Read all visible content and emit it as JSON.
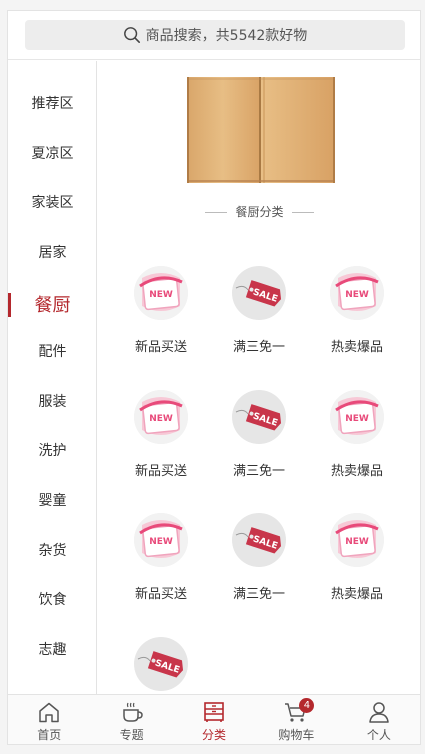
{
  "search": {
    "placeholder": "商品搜索，共5542款好物"
  },
  "sidebar": {
    "items": [
      {
        "label": "推荐区"
      },
      {
        "label": "夏凉区"
      },
      {
        "label": "家装区"
      },
      {
        "label": "居家"
      },
      {
        "label": "餐厨",
        "active": true
      },
      {
        "label": "配件"
      },
      {
        "label": "服装"
      },
      {
        "label": "洗护"
      },
      {
        "label": "婴童"
      },
      {
        "label": "杂货"
      },
      {
        "label": "饮食"
      },
      {
        "label": "志趣"
      }
    ]
  },
  "content": {
    "section_title": "餐厨分类",
    "cells": [
      {
        "label": "新品买送",
        "icon": "new-ribbon-icon"
      },
      {
        "label": "满三免一",
        "icon": "sale-tag-icon"
      },
      {
        "label": "热卖爆品",
        "icon": "new-ribbon-icon"
      },
      {
        "label": "新品买送",
        "icon": "new-ribbon-icon"
      },
      {
        "label": "满三免一",
        "icon": "sale-tag-icon"
      },
      {
        "label": "热卖爆品",
        "icon": "new-ribbon-icon"
      },
      {
        "label": "新品买送",
        "icon": "new-ribbon-icon"
      },
      {
        "label": "满三免一",
        "icon": "sale-tag-icon"
      },
      {
        "label": "热卖爆品",
        "icon": "new-ribbon-icon"
      },
      {
        "label": "",
        "icon": "sale-tag-icon"
      }
    ],
    "new_text": "NEW",
    "sale_text": "SALE"
  },
  "tabbar": {
    "tabs": [
      {
        "label": "首页",
        "icon": "home-icon"
      },
      {
        "label": "专题",
        "icon": "cup-icon"
      },
      {
        "label": "分类",
        "icon": "category-icon",
        "active": true
      },
      {
        "label": "购物车",
        "icon": "cart-icon"
      },
      {
        "label": "个人",
        "icon": "user-icon"
      }
    ],
    "cart_badge": "4"
  },
  "colors": {
    "accent": "#b4282d",
    "new_pink": "#e84a7a"
  }
}
